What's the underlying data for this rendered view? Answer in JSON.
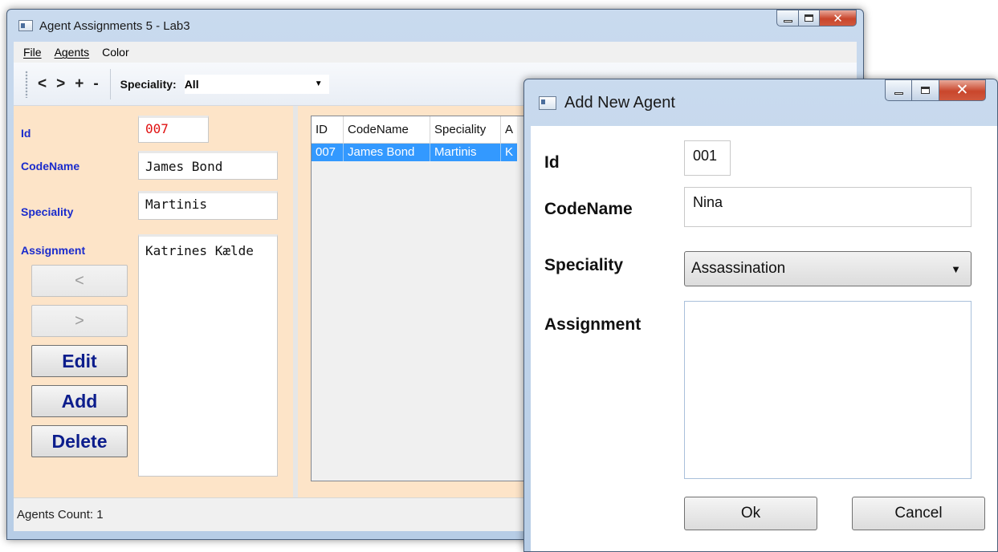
{
  "main_window": {
    "title": "Agent Assignments 5 - Lab3",
    "menu": [
      "File",
      "Agents",
      "Color"
    ],
    "toolbar": {
      "prev": "<",
      "next": ">",
      "add": "+",
      "remove": "-",
      "speciality_label": "Speciality:",
      "speciality_value": "All"
    },
    "form": {
      "id_label": "Id",
      "id_value": "007",
      "codename_label": "CodeName",
      "codename_value": "James Bond",
      "speciality_label": "Speciality",
      "speciality_value": "Martinis",
      "assignment_label": "Assignment",
      "assignment_value": "Katrines Kælde",
      "prev_button": "<",
      "next_button": ">",
      "edit_button": "Edit",
      "add_button": "Add",
      "delete_button": "Delete"
    },
    "grid": {
      "columns": [
        "ID",
        "CodeName",
        "Speciality",
        "A"
      ],
      "rows": [
        {
          "id": "007",
          "codename": "James Bond",
          "speciality": "Martinis",
          "assignment": "K"
        }
      ]
    },
    "status": "Agents Count: 1"
  },
  "dialog": {
    "title": "Add New Agent",
    "id_label": "Id",
    "id_value": "001",
    "codename_label": "CodeName",
    "codename_value": "Nina",
    "speciality_label": "Speciality",
    "speciality_value": "Assassination",
    "assignment_label": "Assignment",
    "assignment_value": "",
    "ok_button": "Ok",
    "cancel_button": "Cancel"
  },
  "colors": {
    "form_background": "#fde4c8",
    "label_blue": "#1a2bcc",
    "id_red": "#e01010",
    "button_text_navy": "#0c1d8c",
    "selection_blue": "#3399ff"
  },
  "icons": {
    "window": "app-window-icon",
    "minimize": "minimize-icon",
    "maximize": "maximize-icon",
    "close": "close-icon",
    "dropdown": "chevron-down-icon"
  }
}
